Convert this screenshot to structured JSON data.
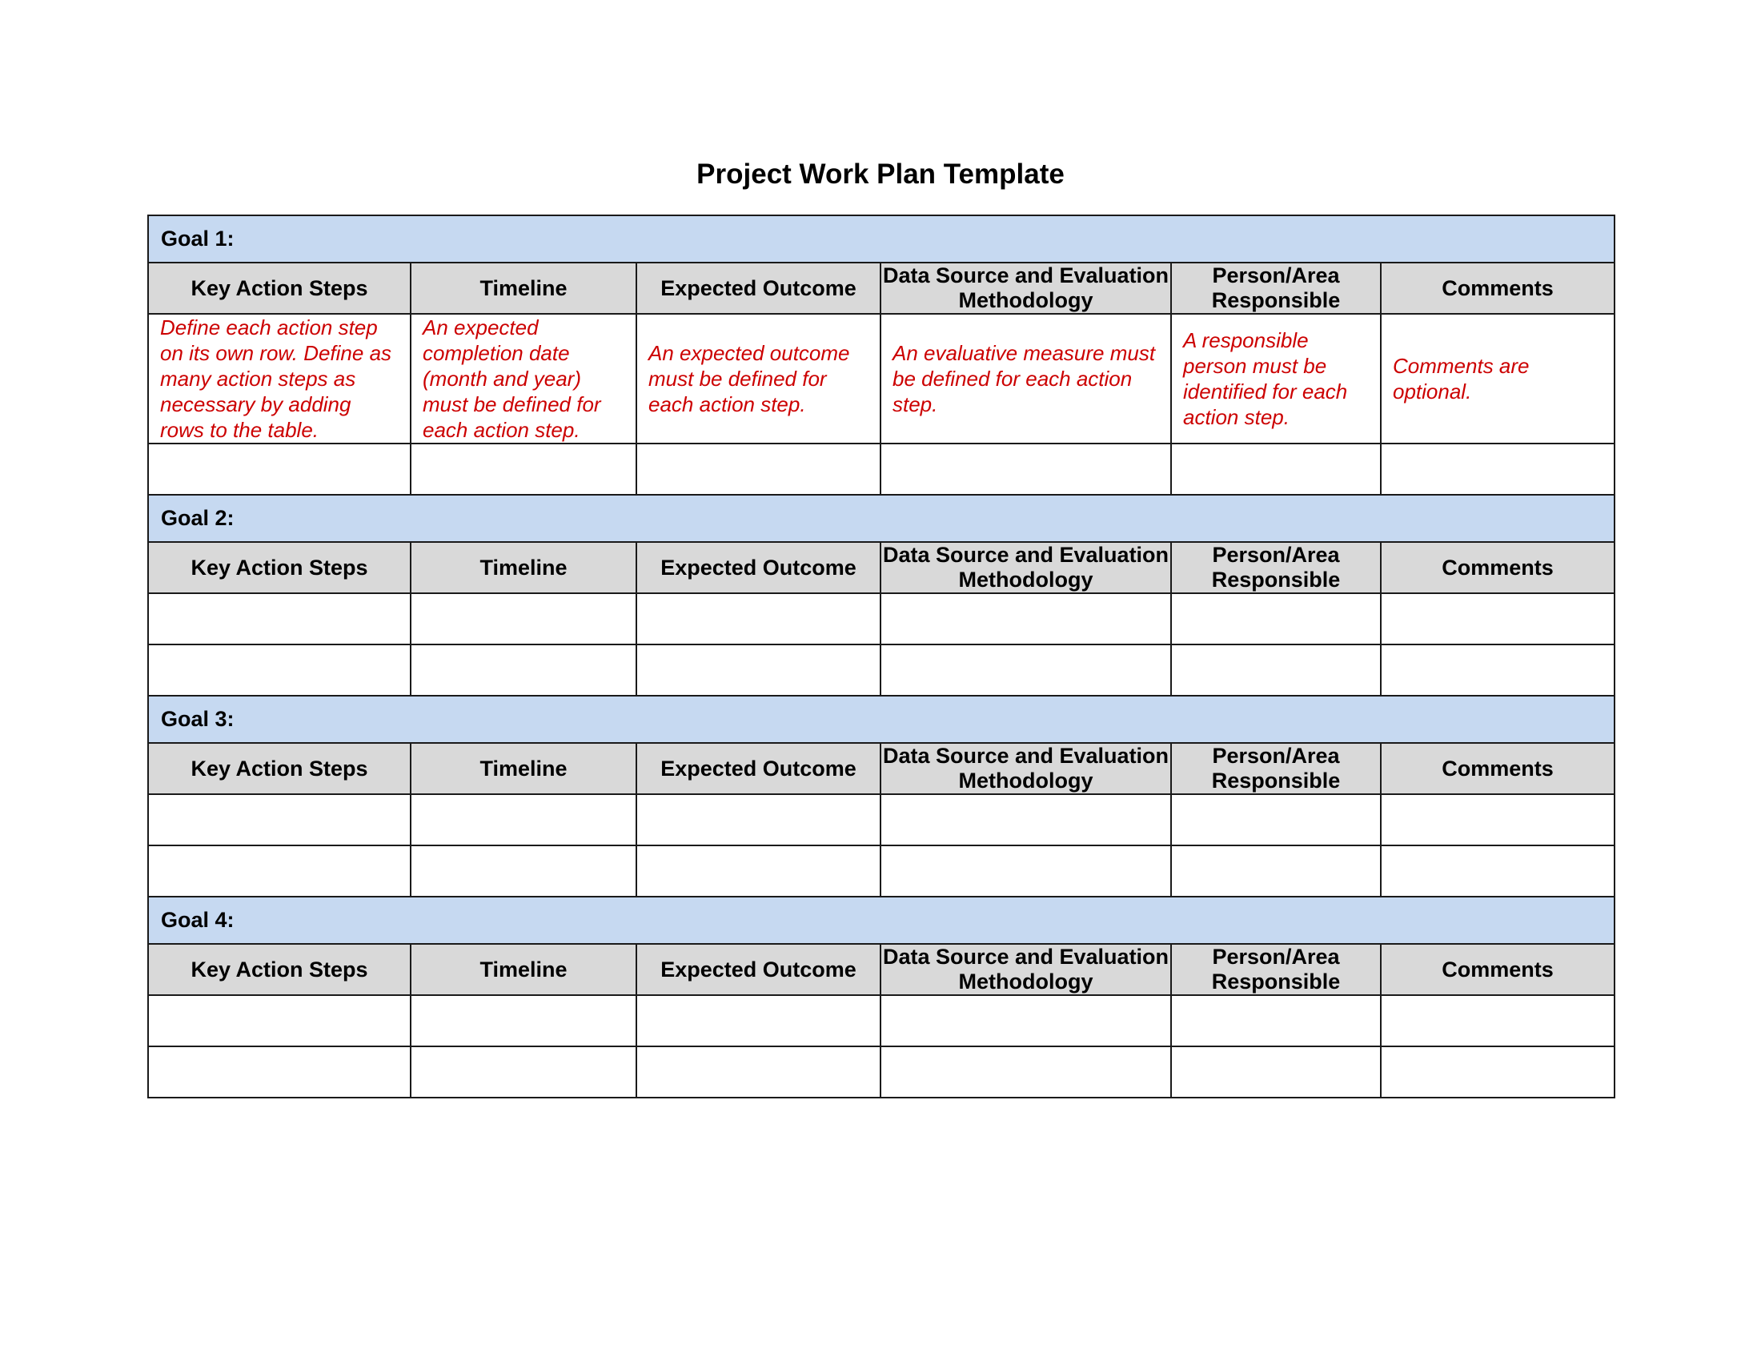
{
  "title": "Project Work Plan Template",
  "columns": [
    "Key Action Steps",
    "Timeline",
    "Expected Outcome",
    "Data Source and Evaluation Methodology",
    "Person/Area Responsible",
    "Comments"
  ],
  "goals": [
    {
      "label": "Goal 1:"
    },
    {
      "label": "Goal 2:"
    },
    {
      "label": "Goal 3:"
    },
    {
      "label": "Goal 4:"
    }
  ],
  "example_row": [
    "Define each action step on its own row. Define as many action steps as necessary by adding rows to the table.",
    "An expected completion date (month and year) must be defined for each action step.",
    "An expected outcome must be defined for each action step.",
    "An evaluative measure must be defined for each action step.",
    "A responsible person must be identified for each action step.",
    "Comments are optional."
  ],
  "colors": {
    "goal_band": "#c6d9f1",
    "header_band": "#d9d9d9",
    "instruction_text": "#cc0000"
  }
}
